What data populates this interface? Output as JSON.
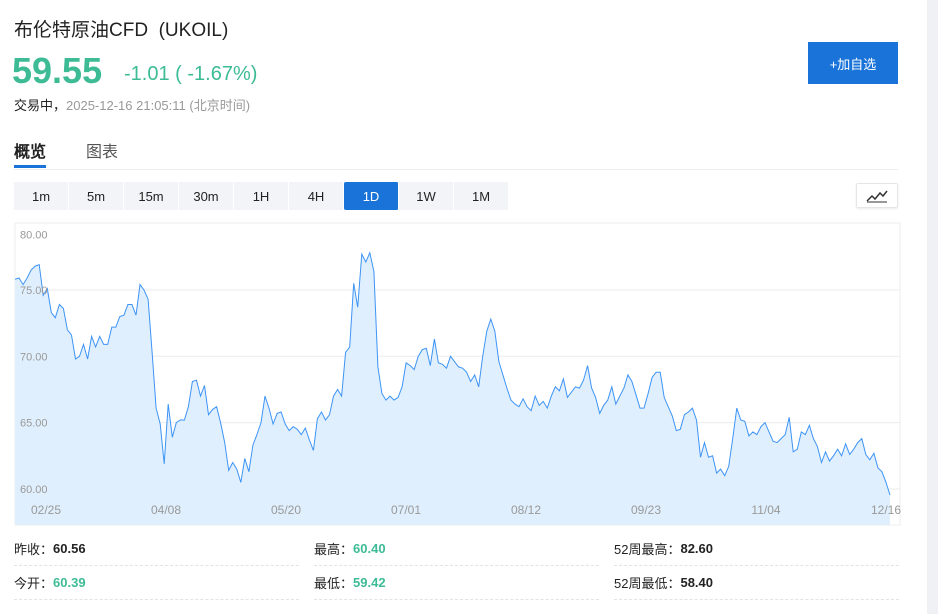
{
  "header": {
    "title": "布伦特原油CFD  (UKOIL)",
    "price": "59.55",
    "change": "-1.01 ( -1.67%)",
    "status_label": "交易中，",
    "timestamp": "2025-12-16 21:05:11 (北京时间)",
    "add_button": "+加自选"
  },
  "tabs": [
    {
      "label": "概览",
      "active": true
    },
    {
      "label": "图表",
      "active": false
    }
  ],
  "periods": [
    {
      "label": "1m"
    },
    {
      "label": "5m"
    },
    {
      "label": "15m"
    },
    {
      "label": "30m"
    },
    {
      "label": "1H"
    },
    {
      "label": "4H"
    },
    {
      "label": "1D",
      "active": true
    },
    {
      "label": "1W"
    },
    {
      "label": "1M"
    }
  ],
  "chart_type_icon": "line-chart-icon",
  "colors": {
    "accent": "#1a73d9",
    "down": "#3dbb95",
    "line": "#3d94f5",
    "fill": "#e0effd"
  },
  "chart_data": {
    "type": "area",
    "ylim": [
      60,
      80
    ],
    "y_ticks": [
      "60.00",
      "65.00",
      "70.00",
      "75.00",
      "80.00"
    ],
    "x_ticks": [
      "02/25",
      "04/08",
      "05/20",
      "07/01",
      "08/12",
      "09/23",
      "11/04",
      "12/16"
    ],
    "grid": true,
    "values": [
      75.8,
      75.9,
      75.4,
      75.9,
      76.5,
      76.8,
      76.9,
      74.6,
      75.1,
      73.3,
      72.9,
      73.9,
      73.6,
      72.0,
      71.6,
      69.8,
      70.0,
      70.9,
      69.8,
      71.5,
      70.7,
      71.5,
      70.9,
      70.9,
      72.2,
      72.2,
      73.0,
      73.1,
      73.9,
      73.9,
      73.1,
      75.4,
      75.0,
      74.3,
      70.3,
      66.1,
      64.9,
      61.9,
      66.4,
      63.9,
      65.0,
      65.2,
      65.2,
      66.2,
      68.1,
      68.2,
      67.0,
      67.8,
      65.6,
      66.0,
      66.2,
      65.0,
      63.5,
      61.4,
      62.0,
      61.5,
      60.5,
      62.3,
      61.3,
      63.3,
      64.1,
      65.0,
      67.0,
      66.1,
      64.9,
      65.7,
      65.8,
      64.9,
      64.4,
      64.7,
      64.5,
      64.1,
      64.6,
      63.7,
      62.9,
      65.3,
      65.8,
      65.2,
      65.6,
      67.0,
      67.5,
      67.0,
      70.3,
      70.7,
      75.5,
      73.7,
      77.7,
      77.1,
      77.8,
      76.4,
      69.2,
      67.2,
      66.7,
      67.0,
      66.7,
      66.9,
      67.7,
      69.5,
      69.3,
      69.0,
      70.0,
      70.5,
      70.6,
      69.3,
      71.3,
      69.5,
      69.4,
      69.1,
      70.0,
      69.6,
      69.2,
      69.1,
      68.8,
      68.1,
      68.6,
      67.7,
      70.0,
      71.9,
      72.8,
      71.9,
      69.6,
      68.6,
      67.6,
      66.7,
      66.4,
      66.2,
      66.8,
      66.2,
      65.9,
      67.0,
      66.3,
      66.6,
      66.1,
      67.0,
      67.7,
      67.4,
      68.3,
      66.9,
      67.3,
      67.7,
      67.6,
      68.2,
      69.3,
      67.6,
      66.9,
      65.7,
      66.3,
      66.7,
      67.7,
      66.4,
      67.0,
      67.6,
      68.6,
      68.1,
      67.1,
      66.1,
      66.1,
      67.2,
      68.4,
      68.8,
      68.8,
      66.9,
      66.2,
      65.5,
      64.4,
      64.5,
      65.6,
      65.8,
      66.1,
      65.2,
      62.4,
      63.5,
      62.4,
      62.5,
      61.2,
      61.5,
      61.0,
      61.7,
      63.8,
      66.1,
      65.2,
      65.1,
      64.0,
      64.3,
      64.1,
      64.7,
      65.0,
      64.3,
      63.6,
      63.5,
      63.8,
      64.1,
      65.4,
      62.8,
      63.0,
      64.3,
      64.1,
      64.8,
      63.8,
      63.2,
      62.0,
      62.8,
      62.1,
      62.5,
      63.0,
      62.5,
      63.4,
      62.6,
      63.0,
      63.5,
      63.8,
      62.6,
      62.2,
      62.7,
      61.6,
      61.3,
      60.5,
      59.55
    ]
  },
  "stats": [
    {
      "label": "昨收：",
      "value": "60.56",
      "color": "normal"
    },
    {
      "label": "最高：",
      "value": "60.40",
      "color": "down"
    },
    {
      "label": "52周最高：",
      "value": "82.60",
      "color": "normal"
    },
    {
      "label": "今开：",
      "value": "60.39",
      "color": "down"
    },
    {
      "label": "最低：",
      "value": "59.42",
      "color": "down"
    },
    {
      "label": "52周最低：",
      "value": "58.40",
      "color": "normal"
    }
  ]
}
